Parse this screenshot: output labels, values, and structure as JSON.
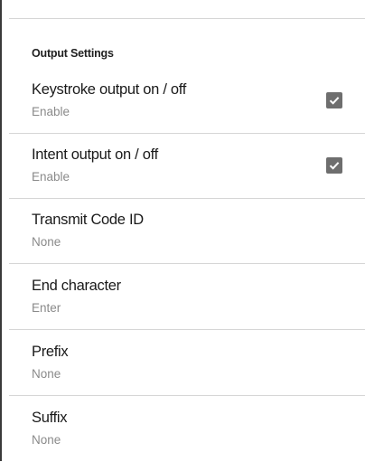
{
  "section": {
    "title": "Output Settings"
  },
  "items": [
    {
      "title": "Keystroke output on / off",
      "summary": "Enable",
      "checked": true
    },
    {
      "title": "Intent output on / off",
      "summary": "Enable",
      "checked": true
    },
    {
      "title": "Transmit Code ID",
      "summary": "None"
    },
    {
      "title": "End character",
      "summary": "Enter"
    },
    {
      "title": "Prefix",
      "summary": "None"
    },
    {
      "title": "Suffix",
      "summary": "None"
    }
  ],
  "colors": {
    "checkbox_fill": "#6e6e6e",
    "divider": "#d6d6d6",
    "summary_text": "#8a8a8a"
  }
}
